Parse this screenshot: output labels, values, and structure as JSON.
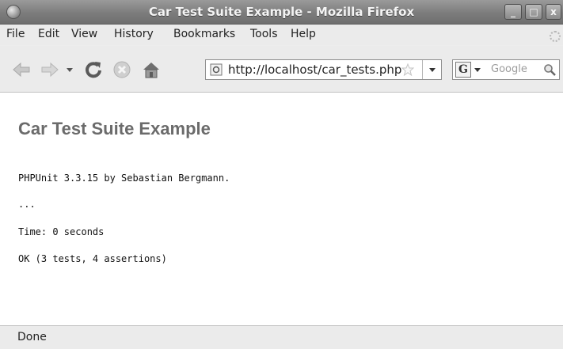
{
  "window": {
    "title": "Car Test Suite Example - Mozilla Firefox",
    "controls": {
      "minimize": "_",
      "maximize": "□",
      "close": "x"
    }
  },
  "menu": {
    "items": [
      "File",
      "Edit",
      "View",
      "History",
      "Bookmarks",
      "Tools",
      "Help"
    ]
  },
  "toolbar": {
    "url": "http://localhost/car_tests.php",
    "search_engine": "G",
    "search_placeholder": "Google"
  },
  "page": {
    "title": "Car Test Suite Example",
    "output": [
      "PHPUnit 3.3.15 by Sebastian Bergmann.",
      "...",
      "Time: 0 seconds",
      "OK (3 tests, 4 assertions)"
    ]
  },
  "status": {
    "text": "Done"
  },
  "colors": {
    "title_bar": "#7c7c7c",
    "chrome": "#ebebeb",
    "page_title": "#6b6b6b"
  },
  "icons": [
    "back-icon",
    "forward-icon",
    "history-dropdown-icon",
    "reload-icon",
    "stop-icon",
    "home-icon",
    "site-identity-icon",
    "bookmark-star-icon",
    "url-dropdown-icon",
    "search-engine-icon",
    "magnifier-icon",
    "throbber-icon"
  ]
}
